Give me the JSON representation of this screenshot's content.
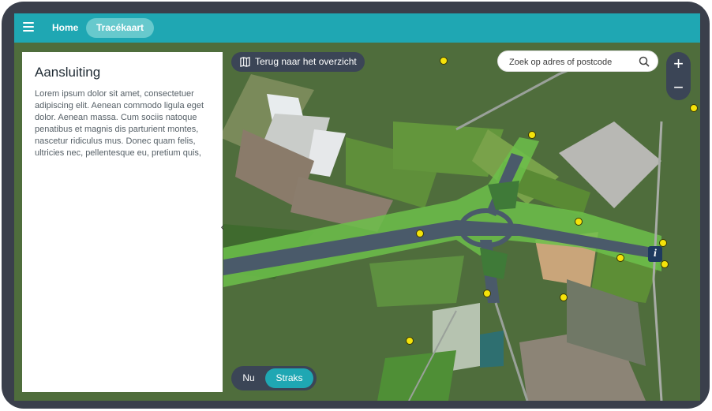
{
  "topbar": {
    "nav": [
      {
        "label": "Home",
        "active": false
      },
      {
        "label": "Tracékaart",
        "active": true
      }
    ]
  },
  "panel": {
    "title": "Aansluiting",
    "body": "Lorem ipsum dolor sit amet, consectetuer adipiscing elit. Aenean commodo ligula eget dolor. Aenean massa. Cum sociis natoque penatibus et magnis dis parturient montes, nascetur ridiculus mus. Donec quam felis, ultricies nec, pellentesque eu, pretium quis,",
    "collapse_glyph": "‹"
  },
  "map": {
    "back_label": "Terug naar het overzicht",
    "search_placeholder": "Zoek op adres of postcode",
    "zoom_in": "+",
    "zoom_out": "−",
    "info_glyph": "i",
    "toggle": {
      "now": "Nu",
      "later": "Straks",
      "selected": "Straks"
    },
    "icons": {
      "menu": "menu-icon",
      "back": "map-icon",
      "search": "search-icon",
      "pin": "marker-pin-icon"
    }
  },
  "colors": {
    "topbar": "#1fa7b3",
    "active_nav": "#67c9cd",
    "dark_controls": "#3b4556",
    "route_green": "#6cc04a",
    "pin_yellow": "#f5e30a"
  }
}
